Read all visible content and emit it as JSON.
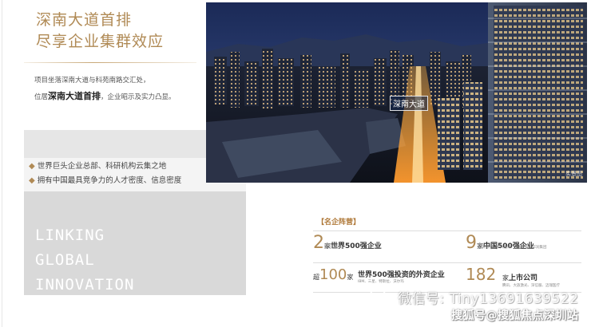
{
  "headline": {
    "line1": "深南大道首排",
    "line2": "尽享企业集群效应"
  },
  "description": {
    "line1": "项目坐落深南大道与科苑南路交汇处，",
    "line2_prefix": "位居",
    "line2_strong": "深南大道首排",
    "line2_suffix": "，企业昭示及实力凸显。"
  },
  "bullets": [
    "世界巨头企业总部、科研机构云集之地",
    "拥有中国最具竞争力的人才密度、信息密度"
  ],
  "slogan": [
    "LINKING",
    "GLOBAL",
    "INNOVATION"
  ],
  "photo": {
    "road_label": "深南大道",
    "render_tag": "实景图"
  },
  "stats": {
    "title": "【名企阵营】",
    "items": [
      {
        "prefix": "",
        "number": "2",
        "unit": "家",
        "label": "世界500强企业",
        "sub": "腾讯、恒大"
      },
      {
        "prefix": "",
        "number": "9",
        "unit": "家",
        "label": "中国500强企业",
        "sub": "招商银行、中兴通讯、中国平安、华润集团"
      },
      {
        "prefix": "超",
        "number": "100",
        "unit": "家",
        "label": "世界500强投资的外资企业",
        "sub": "IBM、三星、特斯拉、沃尔玛"
      },
      {
        "prefix": "",
        "number": "182",
        "unit": "家",
        "label": "上市公司",
        "sub": "腾讯、大族激光、深信服、迈瑞医疗"
      }
    ]
  },
  "watermark": {
    "wechat": "微信号: Tiny13691639522",
    "sohu": "搜狐号@搜狐焦点深圳站"
  },
  "colors": {
    "gold": "#b08a55",
    "panel_gray": "#d9d9d9"
  }
}
